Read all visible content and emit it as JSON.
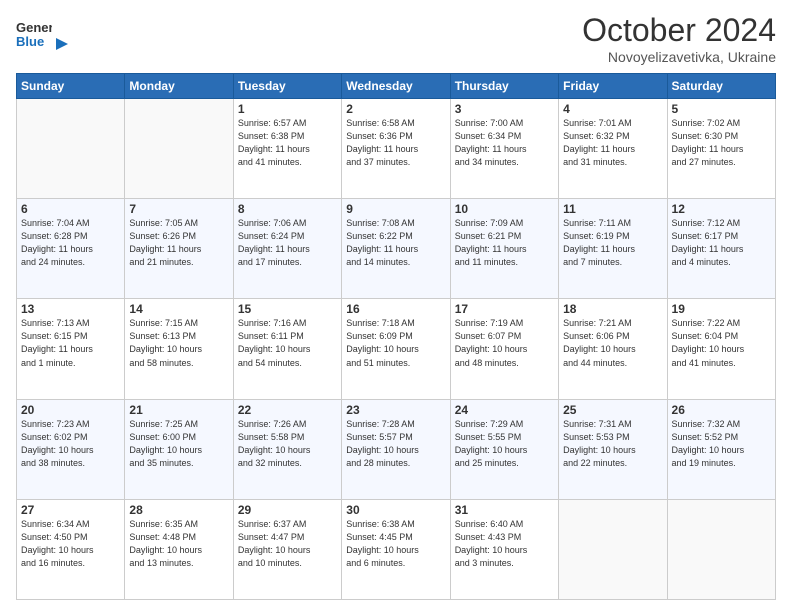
{
  "header": {
    "logo_line1": "General",
    "logo_line2": "Blue",
    "month": "October 2024",
    "location": "Novoyelizavetivka, Ukraine"
  },
  "weekdays": [
    "Sunday",
    "Monday",
    "Tuesday",
    "Wednesday",
    "Thursday",
    "Friday",
    "Saturday"
  ],
  "weeks": [
    [
      {
        "day": "",
        "info": ""
      },
      {
        "day": "",
        "info": ""
      },
      {
        "day": "1",
        "info": "Sunrise: 6:57 AM\nSunset: 6:38 PM\nDaylight: 11 hours\nand 41 minutes."
      },
      {
        "day": "2",
        "info": "Sunrise: 6:58 AM\nSunset: 6:36 PM\nDaylight: 11 hours\nand 37 minutes."
      },
      {
        "day": "3",
        "info": "Sunrise: 7:00 AM\nSunset: 6:34 PM\nDaylight: 11 hours\nand 34 minutes."
      },
      {
        "day": "4",
        "info": "Sunrise: 7:01 AM\nSunset: 6:32 PM\nDaylight: 11 hours\nand 31 minutes."
      },
      {
        "day": "5",
        "info": "Sunrise: 7:02 AM\nSunset: 6:30 PM\nDaylight: 11 hours\nand 27 minutes."
      }
    ],
    [
      {
        "day": "6",
        "info": "Sunrise: 7:04 AM\nSunset: 6:28 PM\nDaylight: 11 hours\nand 24 minutes."
      },
      {
        "day": "7",
        "info": "Sunrise: 7:05 AM\nSunset: 6:26 PM\nDaylight: 11 hours\nand 21 minutes."
      },
      {
        "day": "8",
        "info": "Sunrise: 7:06 AM\nSunset: 6:24 PM\nDaylight: 11 hours\nand 17 minutes."
      },
      {
        "day": "9",
        "info": "Sunrise: 7:08 AM\nSunset: 6:22 PM\nDaylight: 11 hours\nand 14 minutes."
      },
      {
        "day": "10",
        "info": "Sunrise: 7:09 AM\nSunset: 6:21 PM\nDaylight: 11 hours\nand 11 minutes."
      },
      {
        "day": "11",
        "info": "Sunrise: 7:11 AM\nSunset: 6:19 PM\nDaylight: 11 hours\nand 7 minutes."
      },
      {
        "day": "12",
        "info": "Sunrise: 7:12 AM\nSunset: 6:17 PM\nDaylight: 11 hours\nand 4 minutes."
      }
    ],
    [
      {
        "day": "13",
        "info": "Sunrise: 7:13 AM\nSunset: 6:15 PM\nDaylight: 11 hours\nand 1 minute."
      },
      {
        "day": "14",
        "info": "Sunrise: 7:15 AM\nSunset: 6:13 PM\nDaylight: 10 hours\nand 58 minutes."
      },
      {
        "day": "15",
        "info": "Sunrise: 7:16 AM\nSunset: 6:11 PM\nDaylight: 10 hours\nand 54 minutes."
      },
      {
        "day": "16",
        "info": "Sunrise: 7:18 AM\nSunset: 6:09 PM\nDaylight: 10 hours\nand 51 minutes."
      },
      {
        "day": "17",
        "info": "Sunrise: 7:19 AM\nSunset: 6:07 PM\nDaylight: 10 hours\nand 48 minutes."
      },
      {
        "day": "18",
        "info": "Sunrise: 7:21 AM\nSunset: 6:06 PM\nDaylight: 10 hours\nand 44 minutes."
      },
      {
        "day": "19",
        "info": "Sunrise: 7:22 AM\nSunset: 6:04 PM\nDaylight: 10 hours\nand 41 minutes."
      }
    ],
    [
      {
        "day": "20",
        "info": "Sunrise: 7:23 AM\nSunset: 6:02 PM\nDaylight: 10 hours\nand 38 minutes."
      },
      {
        "day": "21",
        "info": "Sunrise: 7:25 AM\nSunset: 6:00 PM\nDaylight: 10 hours\nand 35 minutes."
      },
      {
        "day": "22",
        "info": "Sunrise: 7:26 AM\nSunset: 5:58 PM\nDaylight: 10 hours\nand 32 minutes."
      },
      {
        "day": "23",
        "info": "Sunrise: 7:28 AM\nSunset: 5:57 PM\nDaylight: 10 hours\nand 28 minutes."
      },
      {
        "day": "24",
        "info": "Sunrise: 7:29 AM\nSunset: 5:55 PM\nDaylight: 10 hours\nand 25 minutes."
      },
      {
        "day": "25",
        "info": "Sunrise: 7:31 AM\nSunset: 5:53 PM\nDaylight: 10 hours\nand 22 minutes."
      },
      {
        "day": "26",
        "info": "Sunrise: 7:32 AM\nSunset: 5:52 PM\nDaylight: 10 hours\nand 19 minutes."
      }
    ],
    [
      {
        "day": "27",
        "info": "Sunrise: 6:34 AM\nSunset: 4:50 PM\nDaylight: 10 hours\nand 16 minutes."
      },
      {
        "day": "28",
        "info": "Sunrise: 6:35 AM\nSunset: 4:48 PM\nDaylight: 10 hours\nand 13 minutes."
      },
      {
        "day": "29",
        "info": "Sunrise: 6:37 AM\nSunset: 4:47 PM\nDaylight: 10 hours\nand 10 minutes."
      },
      {
        "day": "30",
        "info": "Sunrise: 6:38 AM\nSunset: 4:45 PM\nDaylight: 10 hours\nand 6 minutes."
      },
      {
        "day": "31",
        "info": "Sunrise: 6:40 AM\nSunset: 4:43 PM\nDaylight: 10 hours\nand 3 minutes."
      },
      {
        "day": "",
        "info": ""
      },
      {
        "day": "",
        "info": ""
      }
    ]
  ]
}
